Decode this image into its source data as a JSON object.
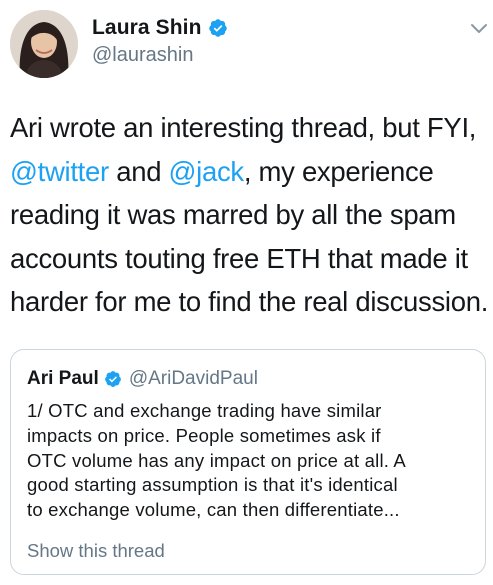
{
  "author": {
    "name": "Laura Shin",
    "handle": "@laurashin",
    "avatar_icon": "profile-photo"
  },
  "tweet": {
    "lines": [
      {
        "parts": [
          {
            "text": "Ari wrote an interesting thread, but FYI,",
            "mention": false
          }
        ]
      },
      {
        "parts": [
          {
            "text": "@twitter",
            "mention": true
          },
          {
            "text": " and ",
            "mention": false
          },
          {
            "text": "@jack",
            "mention": true
          },
          {
            "text": ", my experience",
            "mention": false
          }
        ]
      },
      {
        "parts": [
          {
            "text": "reading it was marred by all the spam",
            "mention": false
          }
        ]
      },
      {
        "parts": [
          {
            "text": "accounts touting free ETH that made it",
            "mention": false
          }
        ]
      },
      {
        "parts": [
          {
            "text": "harder for me to find the real discussion.",
            "mention": false
          }
        ]
      }
    ]
  },
  "quote": {
    "name": "Ari Paul",
    "handle": "@AriDavidPaul",
    "lines": [
      "1/ OTC and exchange trading have similar",
      "impacts on price.  People sometimes ask if",
      "OTC volume has any impact on price at all.  A",
      "good starting assumption is that it's identical",
      "to exchange volume, can then differentiate..."
    ],
    "show_thread": "Show this thread"
  },
  "colors": {
    "link": "#1da1f2",
    "secondary": "#657786",
    "text": "#14171a",
    "border": "#ccd6dd"
  },
  "icons": {
    "verified": "verified-badge-icon",
    "menu": "chevron-down-icon"
  }
}
